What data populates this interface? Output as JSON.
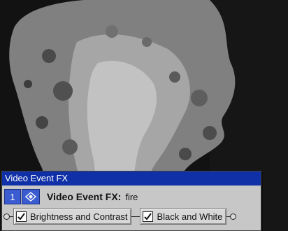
{
  "preview": {
    "content": "fire"
  },
  "fx_window": {
    "title": "Video Event FX",
    "index": "1",
    "header_label": "Video Event FX:",
    "event_name": "fire",
    "plugins": [
      {
        "label": "Brightness and Contrast",
        "checked": true
      },
      {
        "label": "Black and White",
        "checked": true
      }
    ]
  },
  "colors": {
    "titlebar": "#1030a8",
    "window_bg": "#c7c7c7",
    "badge": "#3b5bd1"
  },
  "icons": [
    "preset-icon",
    "checkmark-icon",
    "port-icon"
  ]
}
